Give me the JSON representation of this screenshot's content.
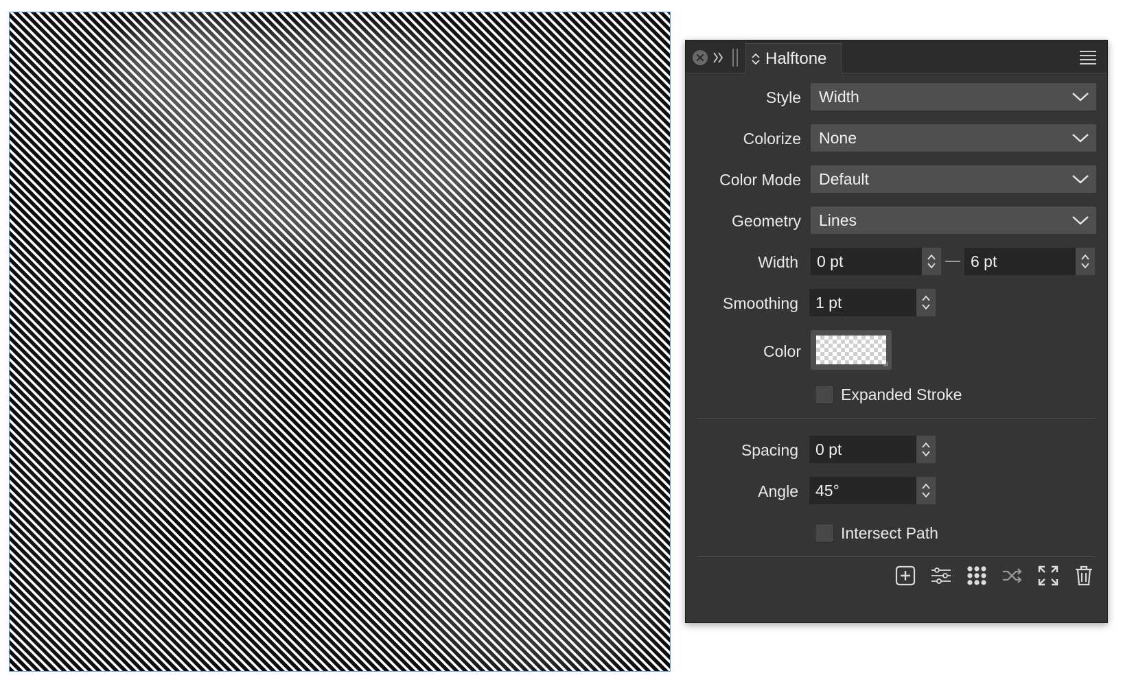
{
  "panel": {
    "title": "Halftone",
    "fields": {
      "style": {
        "label": "Style",
        "value": "Width"
      },
      "colorize": {
        "label": "Colorize",
        "value": "None"
      },
      "color_mode": {
        "label": "Color Mode",
        "value": "Default"
      },
      "geometry": {
        "label": "Geometry",
        "value": "Lines"
      },
      "width": {
        "label": "Width",
        "min": "0 pt",
        "max": "6 pt"
      },
      "smoothing": {
        "label": "Smoothing",
        "value": "1 pt"
      },
      "color": {
        "label": "Color",
        "value": "transparent"
      },
      "expanded_stroke": {
        "label": "Expanded Stroke",
        "checked": false
      },
      "spacing": {
        "label": "Spacing",
        "value": "0 pt"
      },
      "angle": {
        "label": "Angle",
        "value": "45°"
      },
      "intersect_path": {
        "label": "Intersect Path",
        "checked": false
      }
    },
    "footer_icons": [
      "add-icon",
      "sliders-icon",
      "dot-grid-icon",
      "shuffle-icon",
      "expand-icon",
      "trash-icon"
    ]
  },
  "colors": {
    "panel_bg": "#353535",
    "dropdown_bg": "#4f4f4f",
    "field_bg": "#262626",
    "selection_border": "#5a9ef0"
  }
}
